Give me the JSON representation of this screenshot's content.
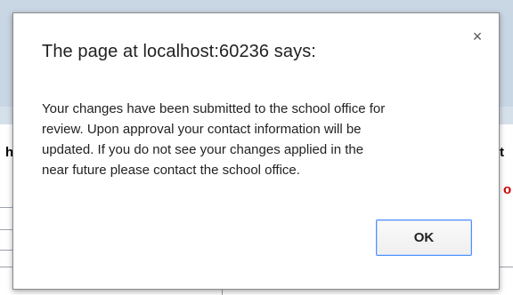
{
  "dialog": {
    "title": "The page at localhost:60236 says:",
    "message": "Your changes have been submitted to the school office for\nreview.  Upon approval your contact information will be\nupdated.  If you do not see your changes applied in the\nnear future please contact the school office.",
    "ok_label": "OK",
    "close_icon": "close-icon",
    "close_glyph": "×"
  },
  "background": {
    "left_fragment": "h",
    "right_fragment": "t",
    "right_red_fragment": "o"
  }
}
